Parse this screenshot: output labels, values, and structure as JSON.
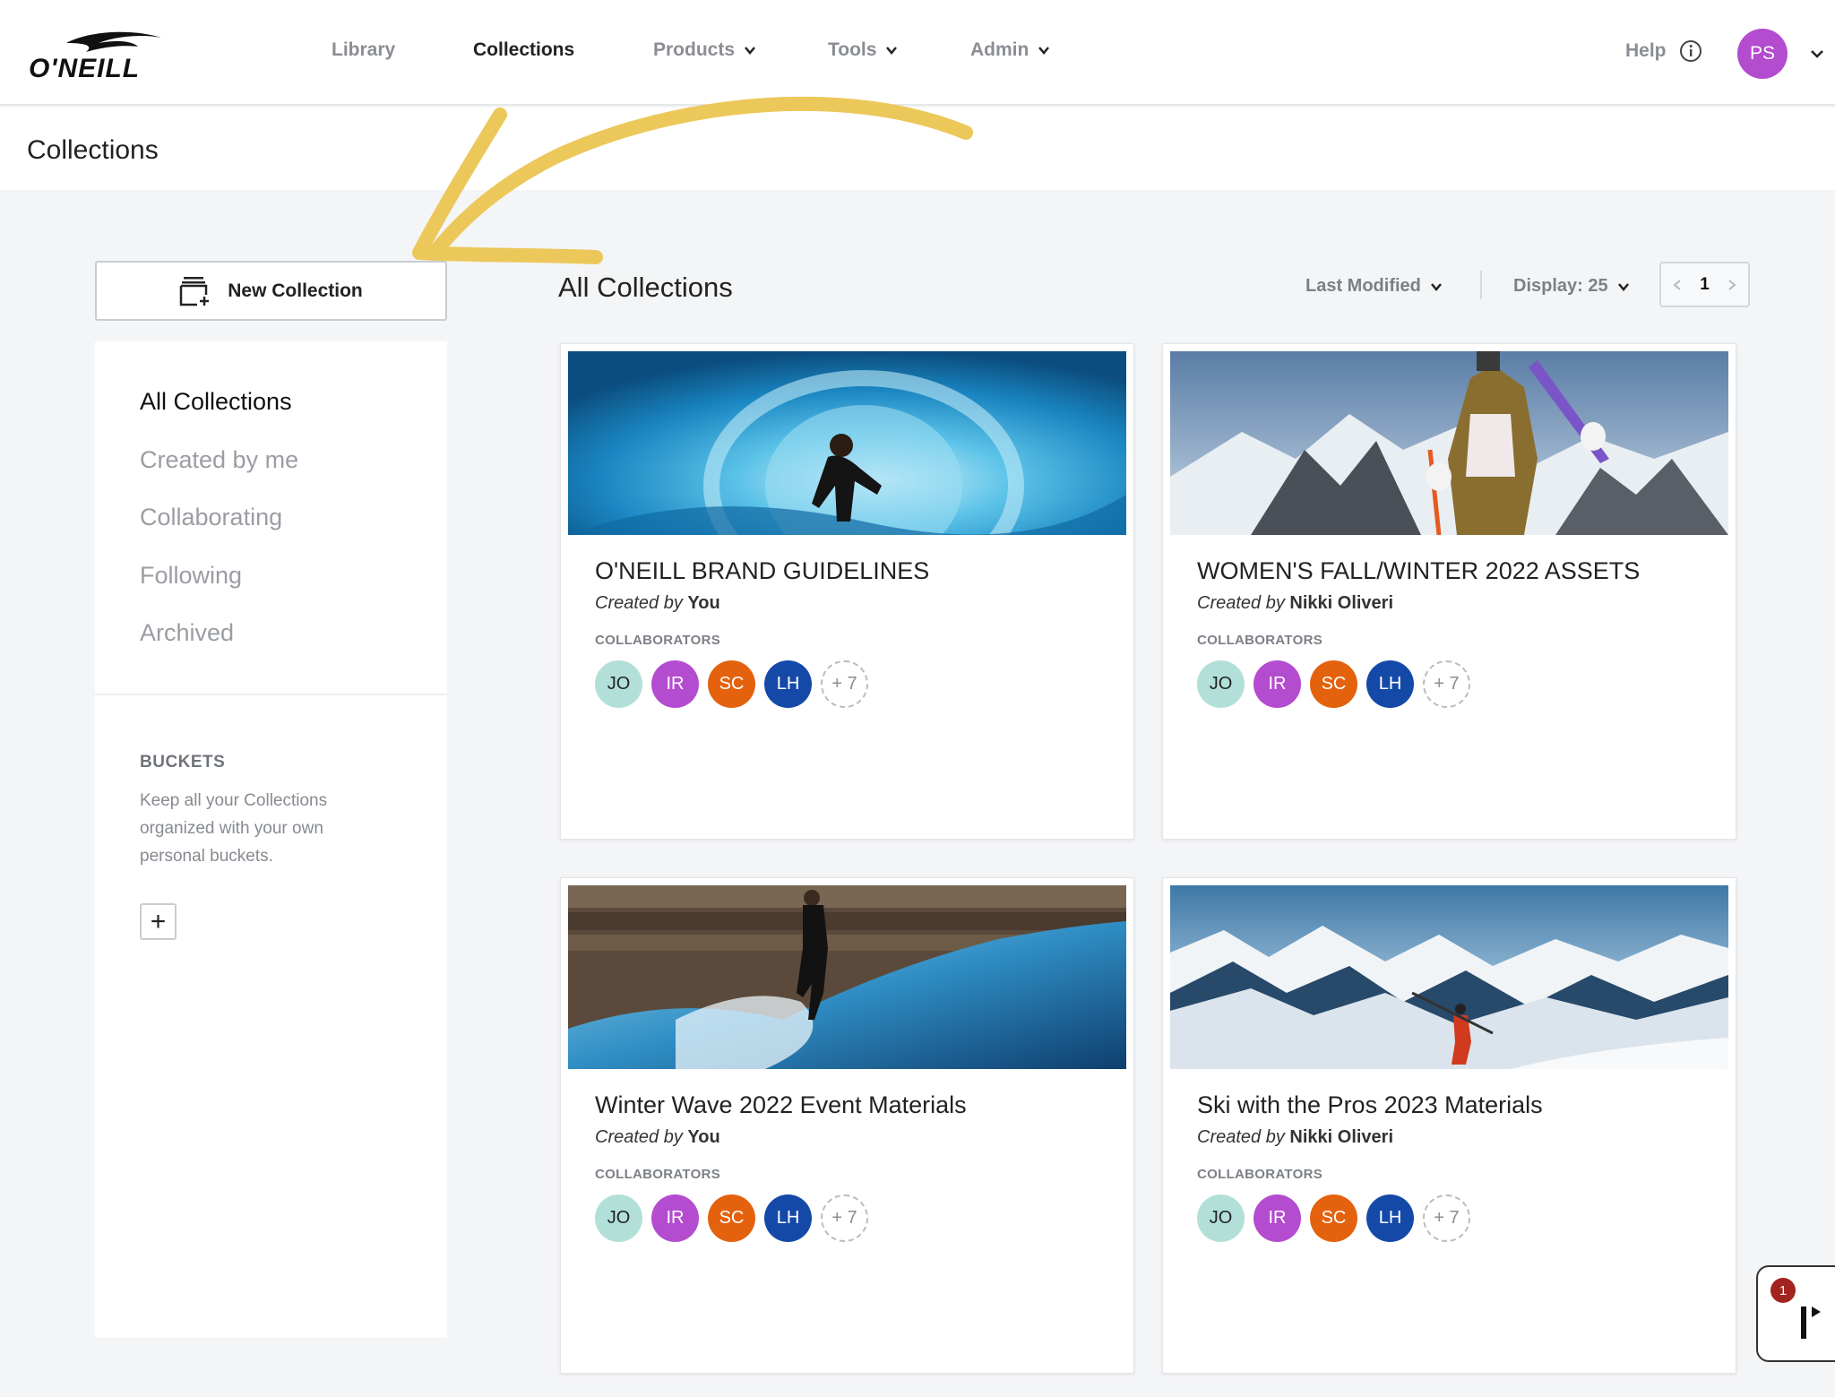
{
  "nav": {
    "brand": "O'NEILL",
    "links": [
      "Library",
      "Collections",
      "Products",
      "Tools",
      "Admin"
    ],
    "help_label": "Help",
    "user_initials": "PS",
    "user_color": "#b44ccf"
  },
  "page": {
    "title": "Collections"
  },
  "sidebar": {
    "new_collection_label": "New Collection",
    "items": [
      "All Collections",
      "Created by me",
      "Collaborating",
      "Following",
      "Archived"
    ],
    "buckets_title": "BUCKETS",
    "buckets_desc": "Keep all your Collections organized with your own personal buckets.",
    "add_bucket": "+"
  },
  "main": {
    "title": "All Collections",
    "sort_label": "Last Modified",
    "display_label": "Display: 25",
    "page_number": "1"
  },
  "collab_label": "COLLABORATORS",
  "collaborators": [
    {
      "initials": "JO",
      "color": "#b2e0d9",
      "text": "#222"
    },
    {
      "initials": "IR",
      "color": "#b44ccf",
      "text": "#fff"
    },
    {
      "initials": "SC",
      "color": "#e4620d",
      "text": "#fff"
    },
    {
      "initials": "LH",
      "color": "#1549a8",
      "text": "#fff"
    }
  ],
  "more_count": "+ 7",
  "cards": [
    {
      "title": "O'NEILL BRAND GUIDELINES",
      "created_label": "Created by",
      "creator": "You"
    },
    {
      "title": "WOMEN'S FALL/WINTER 2022 ASSETS",
      "created_label": "Created by",
      "creator": "Nikki Oliveri"
    },
    {
      "title": "Winter Wave 2022 Event Materials",
      "created_label": "Created by",
      "creator": "You"
    },
    {
      "title": "Ski with the Pros 2023 Materials",
      "created_label": "Created by",
      "creator": "Nikki Oliveri"
    }
  ],
  "chat": {
    "badge_count": "1",
    "badge_color": "#a3231f"
  },
  "colors": {
    "annotation_arrow": "#ecc85a"
  }
}
